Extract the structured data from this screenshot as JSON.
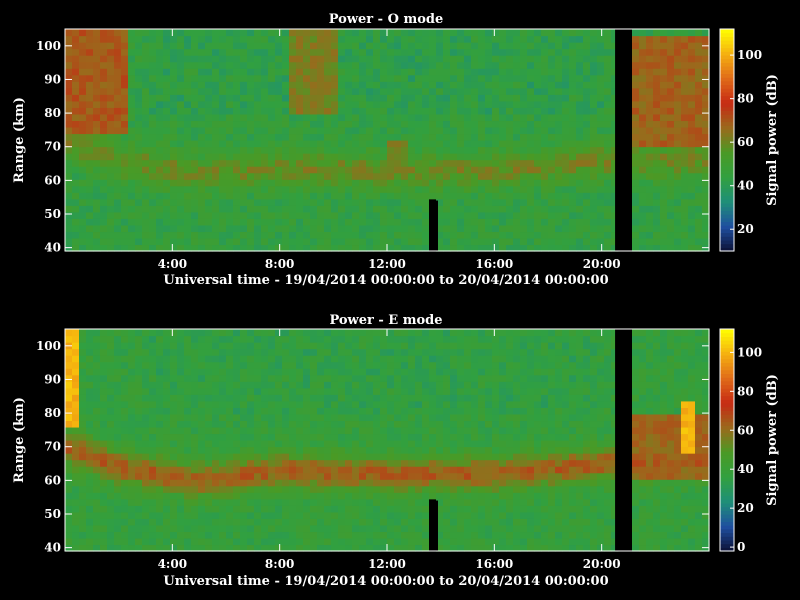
{
  "figure": {
    "background": "#000000",
    "colormap": [
      "#0b1034",
      "#1f4fa0",
      "#1d8f78",
      "#31a040",
      "#4a9a25",
      "#9a6a1c",
      "#c62a14",
      "#e06a18",
      "#f5b010",
      "#ffff00"
    ]
  },
  "chart_data": [
    {
      "type": "heatmap",
      "title": "Power - O mode",
      "xlabel": "Universal time - 19/04/2014 00:00:00 to 20/04/2014 00:00:00",
      "ylabel": "Range (km)",
      "xlim": [
        0,
        24
      ],
      "ylim": [
        39,
        105
      ],
      "x_ticks": [
        4,
        8,
        12,
        16,
        20
      ],
      "x_tick_labels": [
        "4:00",
        "8:00",
        "12:00",
        "16:00",
        "20:00"
      ],
      "y_ticks": [
        40,
        50,
        60,
        70,
        80,
        90,
        100
      ],
      "y_tick_labels": [
        "40",
        "50",
        "60",
        "70",
        "80",
        "90",
        "100"
      ],
      "colorbar": {
        "label": "Signal power (dB)",
        "range": [
          10,
          112
        ],
        "ticks": [
          20,
          40,
          60,
          80,
          100
        ],
        "tick_labels": [
          "20",
          "40",
          "60",
          "80",
          "100"
        ]
      },
      "background_level_db": 45,
      "layer": {
        "description": "enhanced layer near 60-65 km",
        "center_km": [
          [
            0,
            72
          ],
          [
            2,
            66
          ],
          [
            5,
            62
          ],
          [
            8,
            64
          ],
          [
            12,
            63
          ],
          [
            16,
            63
          ],
          [
            20,
            66
          ],
          [
            24,
            66
          ]
        ],
        "peak_db": 60
      },
      "upper_enhancements": [
        {
          "t0": 0,
          "t1": 2.4,
          "h0": 73,
          "h1": 105,
          "db": 74
        },
        {
          "t0": 8.4,
          "t1": 10.2,
          "h0": 80,
          "h1": 105,
          "db": 66
        },
        {
          "t0": 12.0,
          "t1": 12.9,
          "h0": 66,
          "h1": 72,
          "db": 66
        },
        {
          "t0": 20.9,
          "t1": 24,
          "h0": 70,
          "h1": 103,
          "db": 72
        }
      ],
      "data_gaps": [
        {
          "t0": 13.6,
          "t1": 13.9,
          "h0": 39,
          "h1": 54
        },
        {
          "t0": 20.5,
          "t1": 21.0,
          "h0": 39,
          "h1": 105
        }
      ]
    },
    {
      "type": "heatmap",
      "title": "Power - E mode",
      "xlabel": "Universal time - 19/04/2014 00:00:00 to 20/04/2014 00:00:00",
      "ylabel": "Range (km)",
      "xlim": [
        0,
        24
      ],
      "ylim": [
        39,
        105
      ],
      "x_ticks": [
        4,
        8,
        12,
        16,
        20
      ],
      "x_tick_labels": [
        "4:00",
        "8:00",
        "12:00",
        "16:00",
        "20:00"
      ],
      "y_ticks": [
        40,
        50,
        60,
        70,
        80,
        90,
        100
      ],
      "y_tick_labels": [
        "40",
        "50",
        "60",
        "70",
        "80",
        "90",
        "100"
      ],
      "colorbar": {
        "label": "Signal power (dB)",
        "range": [
          -2,
          112
        ],
        "ticks": [
          0,
          20,
          40,
          60,
          80,
          100
        ],
        "tick_labels": [
          "0",
          "20",
          "40",
          "60",
          "80",
          "100"
        ]
      },
      "background_level_db": 38,
      "layer": {
        "description": "enhanced layer near 60-65 km",
        "center_km": [
          [
            0,
            70
          ],
          [
            2,
            64
          ],
          [
            5,
            60
          ],
          [
            8,
            63
          ],
          [
            12,
            62
          ],
          [
            16,
            62
          ],
          [
            20,
            65
          ],
          [
            24,
            66
          ]
        ],
        "peak_db": 64
      },
      "upper_enhancements": [
        {
          "t0": 0,
          "t1": 0.6,
          "h0": 75,
          "h1": 105,
          "db": 104
        },
        {
          "t0": 20.9,
          "t1": 24,
          "h0": 60,
          "h1": 80,
          "db": 66
        },
        {
          "t0": 23.0,
          "t1": 23.6,
          "h0": 68,
          "h1": 84,
          "db": 104
        }
      ],
      "data_gaps": [
        {
          "t0": 13.6,
          "t1": 13.9,
          "h0": 39,
          "h1": 54
        },
        {
          "t0": 20.5,
          "t1": 21.0,
          "h0": 39,
          "h1": 105
        }
      ]
    }
  ]
}
